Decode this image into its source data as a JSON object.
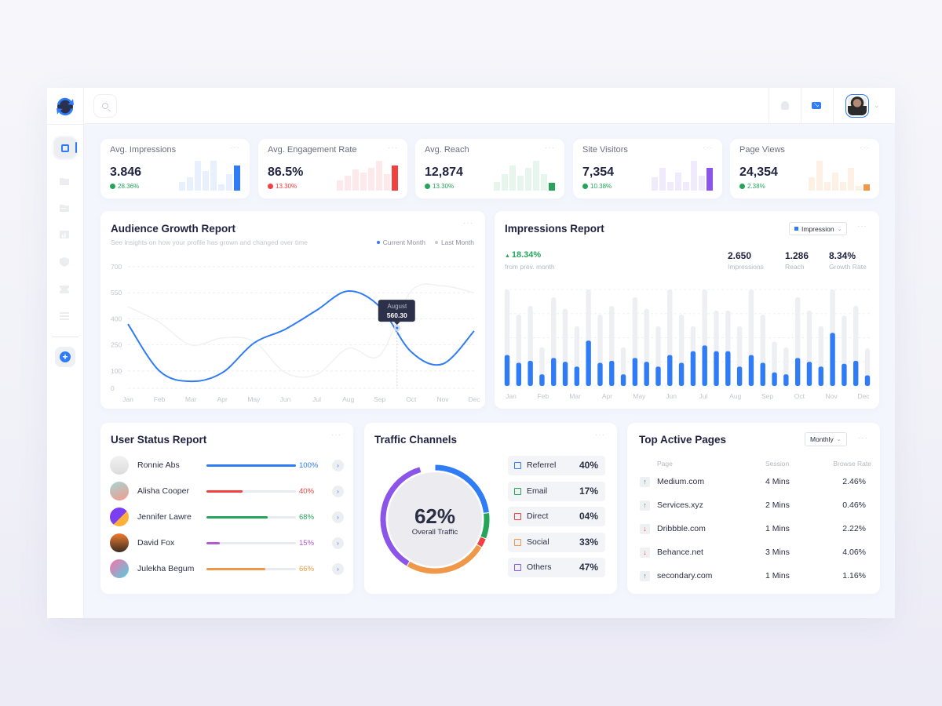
{
  "header": {
    "search_icon": "search-icon",
    "notification_icon": "bell-icon",
    "mail_icon": "mail-icon",
    "profile_menu_icon": "chevron-down-icon"
  },
  "sidebar": {
    "logo_icon": "logo-icon",
    "items": [
      {
        "name": "dashboard",
        "icon": "dashboard-icon",
        "active": true
      },
      {
        "name": "folder",
        "icon": "folder-icon"
      },
      {
        "name": "documents",
        "icon": "folder-alt-icon"
      },
      {
        "name": "analytics",
        "icon": "bar-chart-icon"
      },
      {
        "name": "security",
        "icon": "shield-icon"
      },
      {
        "name": "tickets",
        "icon": "ticket-icon"
      },
      {
        "name": "list",
        "icon": "list-icon"
      }
    ],
    "add_icon": "plus-circle-icon",
    "add_label": "+"
  },
  "colors": {
    "blue": "#2f7cf6",
    "red": "#f0403f",
    "green": "#25a55a",
    "purple": "#8a55e8",
    "orange": "#f0984a",
    "dark": "#1f2340"
  },
  "stats": [
    {
      "label": "Avg. Impressions",
      "value": "3.846",
      "change": "28.36%",
      "trend": "up",
      "color": "#2f7cf6",
      "tint": "#e9f0fd",
      "spark": [
        0.3,
        0.45,
        1.0,
        0.65,
        1.0,
        0.2,
        0.55,
        0.85
      ],
      "menu": "···"
    },
    {
      "label": "Avg. Engagement Rate",
      "value": "86.5%",
      "change": "13.30%",
      "trend": "down",
      "color": "#f0403f",
      "tint": "#fde9e9",
      "spark": [
        0.35,
        0.5,
        0.7,
        0.6,
        0.75,
        1.0,
        0.55,
        0.85
      ],
      "menu": "···"
    },
    {
      "label": "Avg. Reach",
      "value": "12,874",
      "change": "13.30%",
      "trend": "up",
      "color": "#25a55a",
      "tint": "#e6f6ec",
      "spark": [
        0.3,
        0.55,
        0.85,
        0.5,
        0.75,
        1.0,
        0.55,
        0.25
      ],
      "menu": "···"
    },
    {
      "label": "Site Visitors",
      "value": "7,354",
      "change": "10.38%",
      "trend": "up",
      "color": "#8a55e8",
      "tint": "#efeafc",
      "spark": [
        0.45,
        0.75,
        0.3,
        0.6,
        0.3,
        1.0,
        0.5,
        0.75
      ],
      "menu": "···"
    },
    {
      "label": "Page Views",
      "value": "24,354",
      "change": "2.38%",
      "trend": "up",
      "color": "#f0984a",
      "tint": "#fdf1e6",
      "spark": [
        0.45,
        1.0,
        0.3,
        0.6,
        0.3,
        0.75,
        0.15,
        0.22
      ],
      "menu": "···"
    }
  ],
  "audience": {
    "title": "Audience Growth Report",
    "subtitle": "See insights on how your profile has grown and changed over time",
    "legend_current": "Current Month",
    "legend_last": "Last Month",
    "menu": "···",
    "tooltip_month": "August",
    "tooltip_value": "560.30"
  },
  "impressions": {
    "title": "Impressions Report",
    "dropdown": "Impression",
    "growth": "18.34%",
    "growth_label": "from prev. month",
    "metrics": [
      {
        "value": "2.650",
        "label": "Impressions"
      },
      {
        "value": "1.286",
        "label": "Reach"
      },
      {
        "value": "8.34%",
        "label": "Growth Rate"
      }
    ],
    "menu": "···"
  },
  "chart_data": [
    {
      "type": "line",
      "title": "Audience Growth Report",
      "x": [
        "Jan",
        "Feb",
        "Mar",
        "Apr",
        "May",
        "Jun",
        "Jul",
        "Aug",
        "Sep",
        "Oct",
        "Nov",
        "Dec"
      ],
      "series": [
        {
          "name": "Current Month",
          "values": [
            370,
            100,
            40,
            90,
            260,
            340,
            450,
            560,
            470,
            210,
            140,
            330
          ]
        },
        {
          "name": "Last Month",
          "values": [
            470,
            380,
            250,
            290,
            270,
            90,
            80,
            230,
            190,
            560,
            590,
            550
          ]
        }
      ],
      "yticks": [
        0,
        100,
        250,
        400,
        550,
        700
      ],
      "ylim": [
        0,
        700
      ],
      "grid": true,
      "legend": "top-right",
      "annotation": {
        "x": "Sep",
        "label": "August",
        "value": 560.3
      }
    },
    {
      "type": "bar",
      "title": "Impressions Report",
      "xticks": [
        "Jan",
        "Feb",
        "Mar",
        "Apr",
        "May",
        "Jun",
        "Jul",
        "Aug",
        "Sep",
        "Oct",
        "Nov",
        "Dec"
      ],
      "series": [
        {
          "name": "Impression",
          "values": [
            32,
            24,
            26,
            12,
            29,
            25,
            20,
            47,
            24,
            26,
            12,
            29,
            25,
            20,
            32,
            24,
            36,
            42,
            36,
            36,
            20,
            32,
            24,
            14,
            12,
            29,
            25,
            20,
            55,
            23,
            26,
            11
          ]
        },
        {
          "name": "Total",
          "values": [
            100,
            74,
            83,
            40,
            92,
            80,
            62,
            100,
            74,
            83,
            40,
            92,
            80,
            62,
            100,
            74,
            62,
            100,
            78,
            78,
            62,
            100,
            74,
            46,
            40,
            92,
            78,
            62,
            100,
            73,
            83,
            39
          ]
        }
      ],
      "ylim": [
        0,
        100
      ],
      "grid": true
    },
    {
      "type": "pie",
      "title": "Traffic Channels",
      "categories": [
        "Referrel",
        "Email",
        "Direct",
        "Social",
        "Others"
      ],
      "values": [
        40,
        17,
        4,
        33,
        47
      ],
      "center_value": "62%",
      "center_label": "Overall Traffic"
    }
  ],
  "users": {
    "title": "User Status Report",
    "menu": "···",
    "rows": [
      {
        "name": "Ronnie Abs",
        "percent": "100%",
        "progress": 1.0,
        "color": "#2f7cf6",
        "avatar": "linear-gradient(#f2f2f2,#dcdcdc)"
      },
      {
        "name": "Alisha Cooper",
        "percent": "40%",
        "progress": 0.4,
        "color": "#f0403f",
        "avatar": "linear-gradient(160deg,#a6d6d6,#f29a8a)"
      },
      {
        "name": "Jennifer Lawre",
        "percent": "68%",
        "progress": 0.68,
        "color": "#25a55a",
        "avatar": "linear-gradient(135deg,#7b3ef0 55%,#ffb03a 55%)"
      },
      {
        "name": "David Fox",
        "percent": "15%",
        "progress": 0.15,
        "color": "#b157d9",
        "avatar": "linear-gradient(#f07c2e,#3b2b22)"
      },
      {
        "name": "Julekha Begum",
        "percent": "66%",
        "progress": 0.66,
        "color": "#f0984a",
        "avatar": "linear-gradient(135deg,#ff6fa8,#4fd1e0)"
      }
    ],
    "go_label": "›"
  },
  "traffic": {
    "title": "Traffic Channels",
    "menu": "···",
    "center_value": "62%",
    "center_label": "Overall Traffic",
    "channels": [
      {
        "name": "Referrel",
        "percent": "40%",
        "color": "#2f7cf6"
      },
      {
        "name": "Email",
        "percent": "17%",
        "color": "#25a55a"
      },
      {
        "name": "Direct",
        "percent": "04%",
        "color": "#f0403f"
      },
      {
        "name": "Social",
        "percent": "33%",
        "color": "#f0984a"
      },
      {
        "name": "Others",
        "percent": "47%",
        "color": "#8a55e8"
      }
    ]
  },
  "pages": {
    "title": "Top Active Pages",
    "dropdown": "Monthly",
    "menu": "···",
    "headers": [
      "Page",
      "Session",
      "Browse Rate"
    ],
    "rows": [
      {
        "page": "Medium.com",
        "session": "4 Mins",
        "rate": "2.46%",
        "trend": "up"
      },
      {
        "page": "Services.xyz",
        "session": "2 Mins",
        "rate": "0.46%",
        "trend": "up"
      },
      {
        "page": "Dribbble.com",
        "session": "1 Mins",
        "rate": "2.22%",
        "trend": "down"
      },
      {
        "page": "Behance.net",
        "session": "3 Mins",
        "rate": "4.06%",
        "trend": "down"
      },
      {
        "page": "secondary.com",
        "session": "1 Mins",
        "rate": "1.16%",
        "trend": "up"
      }
    ]
  }
}
